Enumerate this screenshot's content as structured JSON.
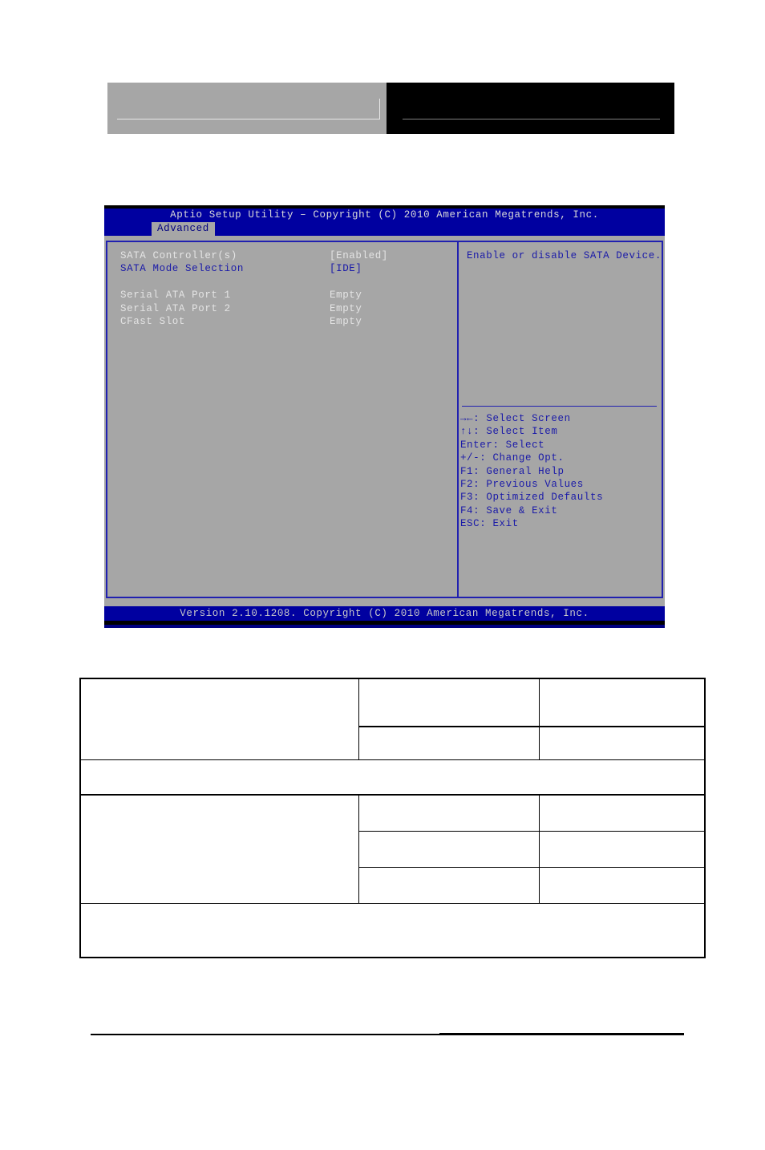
{
  "page": {
    "header": {
      "left_block_name": "header-logo-block",
      "right_block_name": "header-title-block"
    }
  },
  "bios": {
    "title": "Aptio Setup Utility – Copyright (C) 2010 American Megatrends, Inc.",
    "tabs": [
      {
        "label": "Advanced",
        "active": true
      }
    ],
    "settings": [
      {
        "label": "SATA Controller(s)",
        "value": "[Enabled]",
        "style": "white",
        "spacer_after": false
      },
      {
        "label": "SATA Mode Selection",
        "value": "[IDE]",
        "style": "blue",
        "spacer_after": true
      },
      {
        "label": "Serial ATA Port 1",
        "value": "Empty",
        "style": "white",
        "spacer_after": false
      },
      {
        "label": "Serial ATA Port 2",
        "value": "Empty",
        "style": "white",
        "spacer_after": false
      },
      {
        "label": "CFast Slot",
        "value": "Empty",
        "style": "white",
        "spacer_after": false
      }
    ],
    "help_text": "Enable or disable SATA Device.",
    "nav_keys": [
      "→←: Select Screen",
      "↑↓: Select Item",
      "Enter: Select",
      "+/-: Change Opt.",
      "F1: General Help",
      "F2: Previous Values",
      "F3: Optimized Defaults",
      "F4: Save & Exit",
      "ESC: Exit"
    ],
    "footer": "Version 2.10.1208. Copyright (C) 2010 American Megatrends, Inc.",
    "colors": {
      "screen_blue": "#000080",
      "panel_gray": "#a6a6a6",
      "border_blue": "#2020b0",
      "text_white": "#e4e4e4",
      "text_blue": "#1a1aa8"
    }
  },
  "spec_table": {
    "rows": [
      {
        "cells": [
          {
            "text": "",
            "rowspan": 2
          },
          {
            "text": ""
          },
          {
            "text": ""
          }
        ]
      },
      {
        "cells": [
          {
            "text": ""
          },
          {
            "text": ""
          }
        ]
      },
      {
        "cells": [
          {
            "text": "",
            "colspan": 3
          }
        ]
      },
      {
        "cells": [
          {
            "text": "",
            "rowspan": 3
          },
          {
            "text": ""
          },
          {
            "text": ""
          }
        ]
      },
      {
        "cells": [
          {
            "text": ""
          },
          {
            "text": ""
          }
        ]
      },
      {
        "cells": [
          {
            "text": ""
          },
          {
            "text": ""
          }
        ]
      },
      {
        "cells": [
          {
            "text": "",
            "colspan": 3
          }
        ]
      }
    ]
  }
}
